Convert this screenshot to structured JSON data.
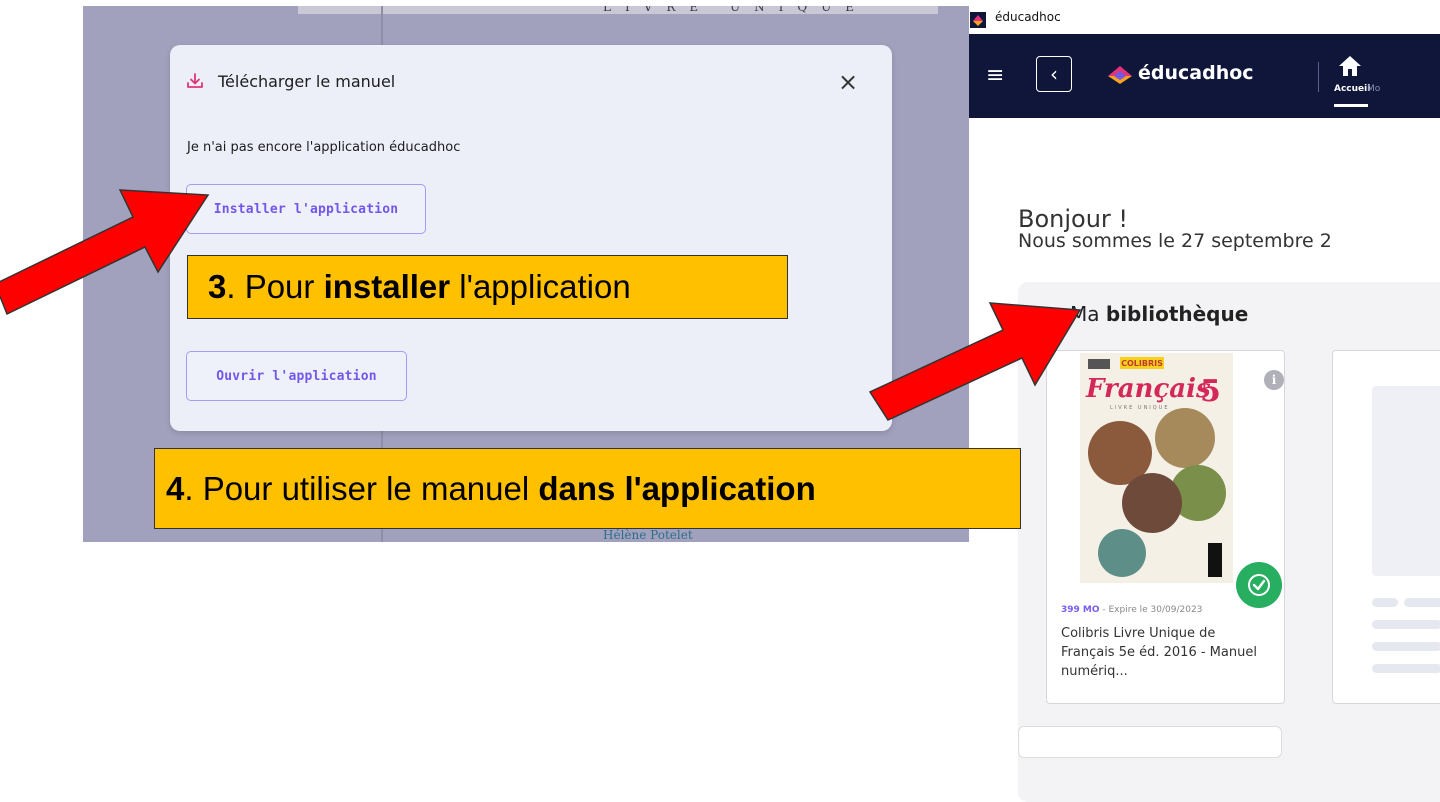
{
  "left_screen": {
    "book_top_text": "LIVRE UNIQUE",
    "book_author": "Hélène Potelet",
    "modal": {
      "title": "Télécharger le manuel",
      "close_symbol": "×",
      "subtitle": "Je n'ai pas encore l'application éducadhoc",
      "install_button": "Installer l'application",
      "open_button": "Ouvrir l'application",
      "icon": "download-icon"
    }
  },
  "callouts": {
    "step3": {
      "number": "3",
      "text_before": ". Pour ",
      "bold": "installer",
      "text_after": " l'application"
    },
    "step4": {
      "number": "4",
      "text_before": ". Pour utiliser le manuel ",
      "bold": "dans l'application",
      "text_after": ""
    }
  },
  "right_screen": {
    "window_title": "éducadhoc",
    "brand": "éducadhoc",
    "nav": {
      "home_label": "Accueil",
      "next_label": "Mo"
    },
    "greeting": "Bonjour !",
    "date_line": "Nous sommes le 27 septembre 2",
    "library": {
      "title_prefix": "Ma ",
      "title_bold": "bibliothèque",
      "book": {
        "size": "399 MO",
        "expiry": " - Expire le 30/09/2023",
        "title": "Colibris Livre Unique de Français 5e éd. 2016 - Manuel numériq...",
        "cover_title": "Français",
        "cover_grade": "5",
        "cover_series": "COLIBRIS",
        "cover_sub": "LIVRE UNIQUE"
      }
    }
  },
  "colors": {
    "accent": "#7357e8",
    "navbar": "#10163a",
    "callout": "#ffc000",
    "arrow": "#ff0000",
    "badge": "#27ae60"
  }
}
